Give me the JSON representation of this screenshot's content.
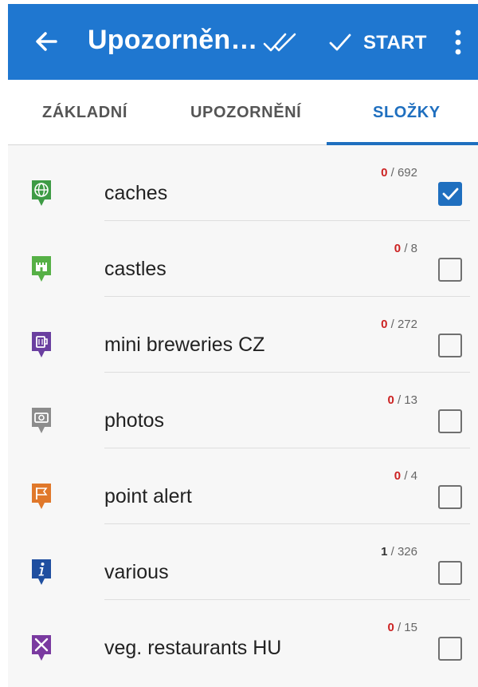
{
  "appbar": {
    "title": "Upozorněn…",
    "start_label": "START"
  },
  "tabs": [
    {
      "label": "ZÁKLADNÍ",
      "selected": false
    },
    {
      "label": "UPOZORNĚNÍ",
      "selected": false
    },
    {
      "label": "SLOŽKY",
      "selected": true
    }
  ],
  "folders": [
    {
      "name": "caches",
      "hit": "0",
      "total": "/ 692",
      "checked": true,
      "icon": "globe-icon",
      "color": "#3e9b45"
    },
    {
      "name": "castles",
      "hit": "0",
      "total": "/ 8",
      "checked": false,
      "icon": "castle-icon",
      "color": "#56b046"
    },
    {
      "name": "mini breweries CZ",
      "hit": "0",
      "total": "/ 272",
      "checked": false,
      "icon": "beer-icon",
      "color": "#6a3fa0"
    },
    {
      "name": "photos",
      "hit": "0",
      "total": "/ 13",
      "checked": false,
      "icon": "camera-icon",
      "color": "#8c8c8c"
    },
    {
      "name": "point alert",
      "hit": "0",
      "total": "/ 4",
      "checked": false,
      "icon": "flag-icon",
      "color": "#e0782a"
    },
    {
      "name": "various",
      "hit": "1",
      "total": "/ 326",
      "checked": false,
      "icon": "info-icon",
      "color": "#1f4fa0"
    },
    {
      "name": "veg. restaurants HU",
      "hit": "0",
      "total": "/ 15",
      "checked": false,
      "icon": "cutlery-icon",
      "color": "#7a3aa0"
    }
  ],
  "colors": {
    "appbar": "#1f77d0",
    "accent": "#1f6fbf",
    "hit_count": "#cc2222"
  }
}
